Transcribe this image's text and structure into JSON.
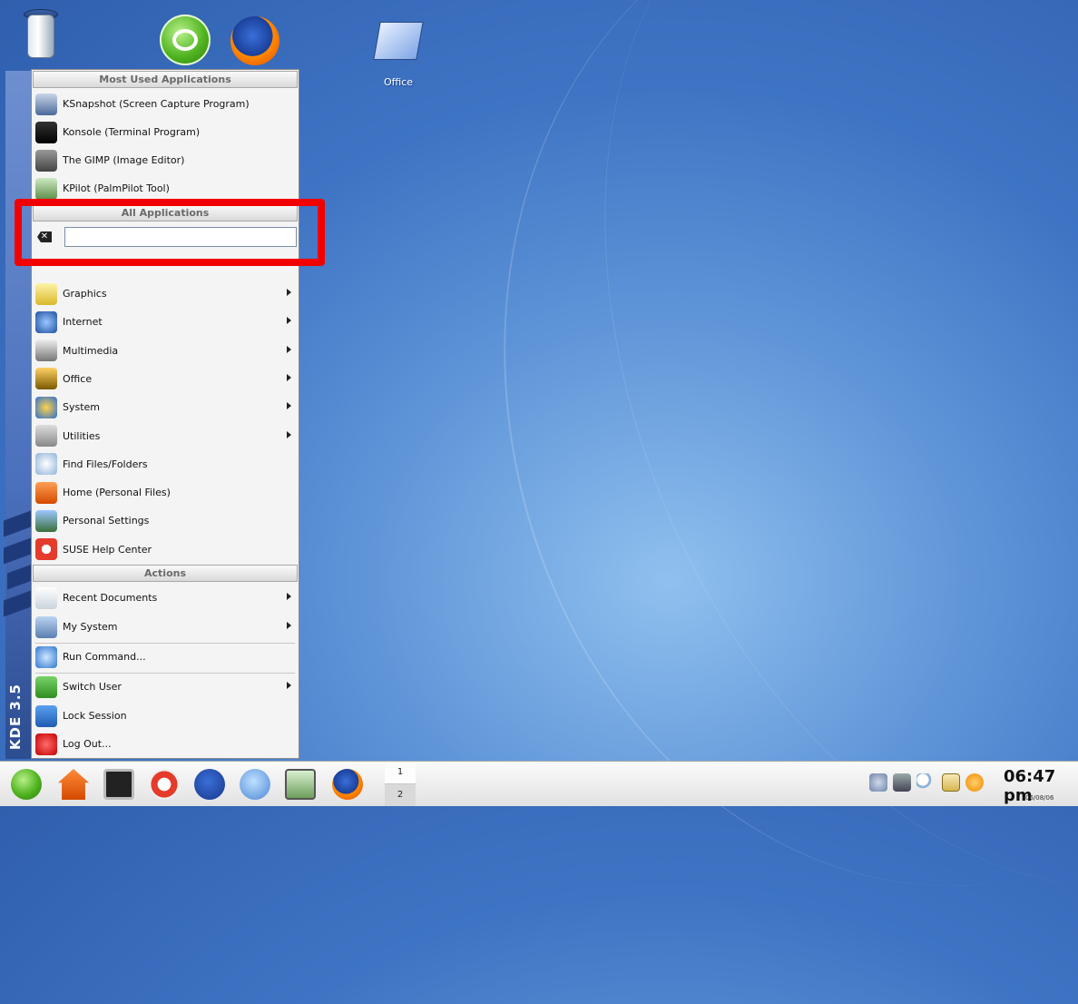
{
  "desktop": {
    "office_label": "Office"
  },
  "menu": {
    "side_version": "KDE 3.5",
    "section_most_used": "Most Used Applications",
    "section_all": "All Applications",
    "section_actions": "Actions",
    "most_used": [
      {
        "label": "KSnapshot (Screen Capture Program)",
        "icon": "camera-icon"
      },
      {
        "label": "Konsole (Terminal Program)",
        "icon": "terminal-icon"
      },
      {
        "label": "The GIMP (Image Editor)",
        "icon": "gimp-icon"
      },
      {
        "label": "KPilot (PalmPilot Tool)",
        "icon": "palm-icon"
      }
    ],
    "search": {
      "value": "",
      "placeholder": ""
    },
    "all_apps": [
      {
        "label": "Graphics",
        "icon": "graphics-icon",
        "submenu": true
      },
      {
        "label": "Internet",
        "icon": "globe-icon",
        "submenu": true
      },
      {
        "label": "Multimedia",
        "icon": "multimedia-icon",
        "submenu": true
      },
      {
        "label": "Office",
        "icon": "office-icon",
        "submenu": true
      },
      {
        "label": "System",
        "icon": "system-icon",
        "submenu": true
      },
      {
        "label": "Utilities",
        "icon": "utilities-icon",
        "submenu": true
      },
      {
        "label": "Find Files/Folders",
        "icon": "find-icon",
        "submenu": false
      },
      {
        "label": "Home (Personal Files)",
        "icon": "home-icon",
        "submenu": false
      },
      {
        "label": "Personal Settings",
        "icon": "settings-icon",
        "submenu": false
      },
      {
        "label": "SUSE Help Center",
        "icon": "help-icon",
        "submenu": false
      }
    ],
    "actions": [
      {
        "label": "Recent Documents",
        "icon": "documents-icon",
        "submenu": true
      },
      {
        "label": "My System",
        "icon": "computer-icon",
        "submenu": true
      },
      {
        "label": "Run Command...",
        "icon": "run-icon",
        "submenu": false
      },
      {
        "label": "Switch User",
        "icon": "switch-user-icon",
        "submenu": true
      },
      {
        "label": "Lock Session",
        "icon": "lock-icon",
        "submenu": false
      },
      {
        "label": "Log Out...",
        "icon": "logout-icon",
        "submenu": false
      }
    ]
  },
  "taskbar": {
    "pager": [
      "1",
      "2"
    ],
    "clock": "06:47 pm",
    "date": "06/08/06"
  },
  "colors": {
    "highlight": "#f20000",
    "desktop": "#4a7fc9"
  }
}
